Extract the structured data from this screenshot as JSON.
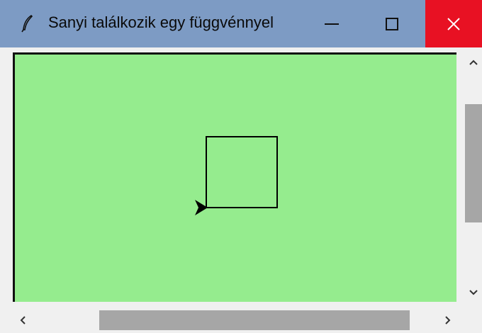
{
  "window": {
    "title": "Sanyi találkozik egy függvénnyel",
    "icons": {
      "app": "feather-icon",
      "minimize": "minimize-icon",
      "maximize": "maximize-icon",
      "close": "close-icon"
    },
    "colors": {
      "titlebar": "#7d9bc4",
      "close_button": "#e81123"
    }
  },
  "canvas": {
    "background": "#95ec8e",
    "drawing": {
      "shape": "square",
      "turtle": "arrow-cursor"
    }
  },
  "scrollbars": {
    "vertical": {
      "up_icon": "chevron-up-icon",
      "down_icon": "chevron-down-icon"
    },
    "horizontal": {
      "left_icon": "chevron-left-icon",
      "right_icon": "chevron-right-icon"
    }
  }
}
